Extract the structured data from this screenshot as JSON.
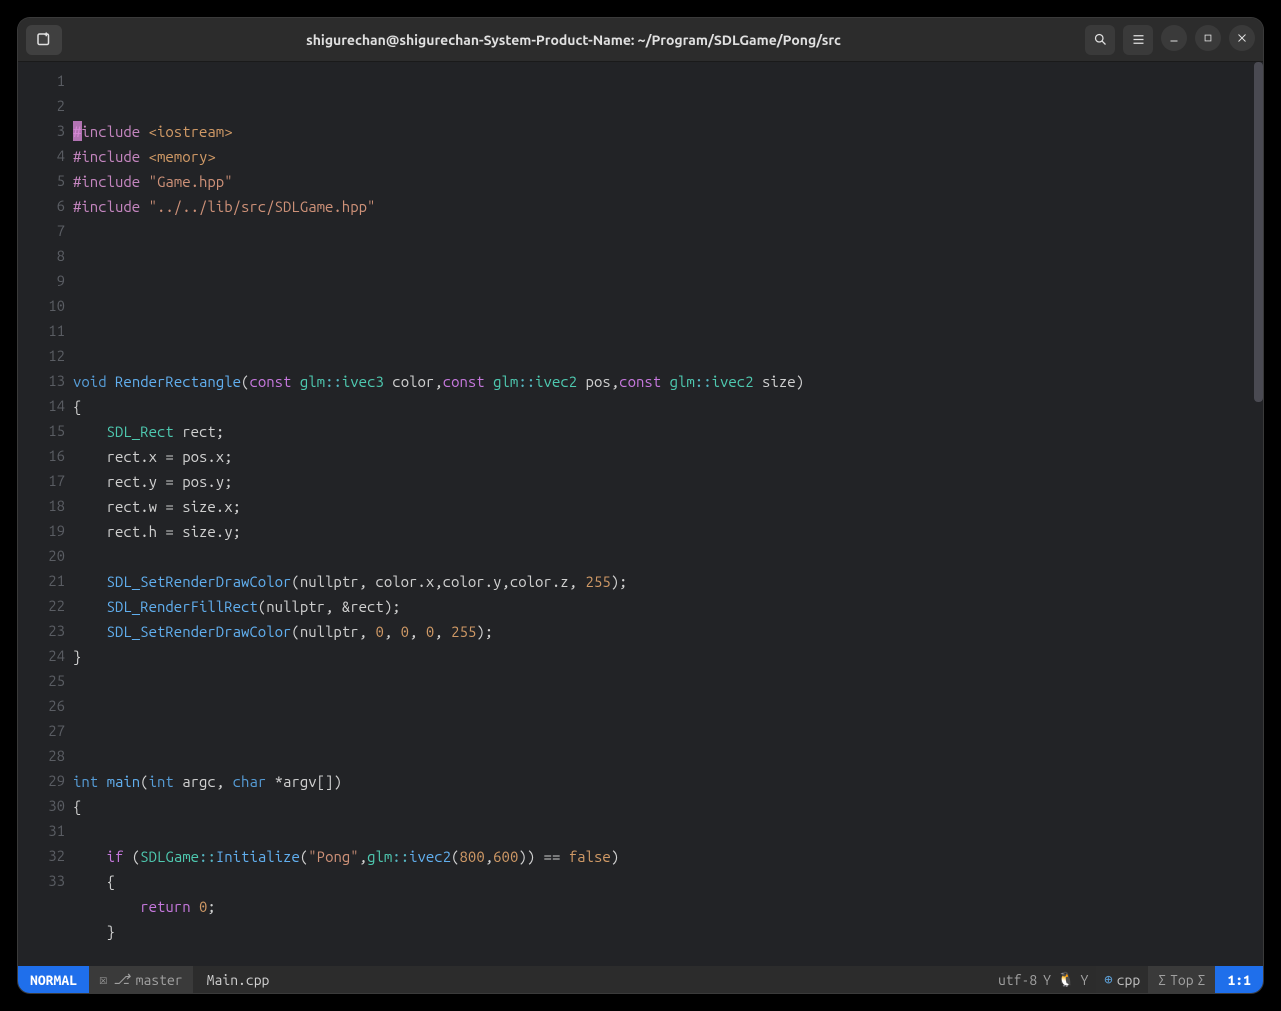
{
  "window": {
    "title": "shigurechan@shigurechan-System-Product-Name: ~/Program/SDLGame/Pong/src"
  },
  "statusbar": {
    "mode": "NORMAL",
    "branch": "master",
    "filename": "Main.cpp",
    "encoding": "utf-8",
    "filetype": "cpp",
    "scroll": "Top",
    "cursor": "1:1"
  },
  "gutter": {
    "start": 1,
    "end": 33
  },
  "code": {
    "lines": [
      {
        "n": 1,
        "t": "pre",
        "html": "<span class='pre'>#include</span> <span class='inc'>&lt;iostream&gt;</span>"
      },
      {
        "n": 2,
        "t": "pre",
        "html": "<span class='pre'>#include</span> <span class='inc'>&lt;memory&gt;</span>"
      },
      {
        "n": 3,
        "t": "pre",
        "html": "<span class='pre'>#include</span> <span class='str'>\"Game.hpp\"</span>"
      },
      {
        "n": 4,
        "t": "pre",
        "html": "<span class='pre'>#include</span> <span class='str'>\"../../lib/src/SDLGame.hpp\"</span>"
      },
      {
        "n": 5,
        "html": ""
      },
      {
        "n": 6,
        "html": ""
      },
      {
        "n": 7,
        "html": ""
      },
      {
        "n": 8,
        "html": ""
      },
      {
        "n": 9,
        "html": ""
      },
      {
        "n": 10,
        "html": ""
      },
      {
        "n": 11,
        "html": "<span class='kw'>void</span> <span class='func'>RenderRectangle</span>(<span class='const-kw'>const</span> <span class='type'>glm</span><span class='op'>::</span><span class='type'>ivec3</span> color,<span class='const-kw'>const</span> <span class='type'>glm</span><span class='op'>::</span><span class='type'>ivec2</span> pos,<span class='const-kw'>const</span> <span class='type'>glm</span><span class='op'>::</span><span class='type'>ivec2</span> size)"
      },
      {
        "n": 12,
        "html": "{"
      },
      {
        "n": 13,
        "html": "    <span class='type'>SDL_Rect</span> rect;"
      },
      {
        "n": 14,
        "html": "    rect.x = pos.x;"
      },
      {
        "n": 15,
        "html": "    rect.y = pos.y;"
      },
      {
        "n": 16,
        "html": "    rect.w = size.x;"
      },
      {
        "n": 17,
        "html": "    rect.h = size.y;"
      },
      {
        "n": 18,
        "html": ""
      },
      {
        "n": 19,
        "html": "    <span class='func'>SDL_SetRenderDrawColor</span>(nullptr, color.x,color.y,color.z, <span class='num'>255</span>);"
      },
      {
        "n": 20,
        "html": "    <span class='func'>SDL_RenderFillRect</span>(nullptr, &amp;rect);"
      },
      {
        "n": 21,
        "html": "    <span class='func'>SDL_SetRenderDrawColor</span>(nullptr, <span class='num'>0</span>, <span class='num'>0</span>, <span class='num'>0</span>, <span class='num'>255</span>);"
      },
      {
        "n": 22,
        "html": "}"
      },
      {
        "n": 23,
        "html": ""
      },
      {
        "n": 24,
        "html": ""
      },
      {
        "n": 25,
        "html": ""
      },
      {
        "n": 26,
        "html": ""
      },
      {
        "n": 27,
        "html": "<span class='kw'>int</span> <span class='func'>main</span>(<span class='kw'>int</span> argc, <span class='kw'>char</span> *argv[])"
      },
      {
        "n": 28,
        "html": "{"
      },
      {
        "n": 29,
        "html": ""
      },
      {
        "n": 30,
        "html": "    <span class='const-kw'>if</span> (<span class='type'>SDLGame</span><span class='op'>::</span><span class='func'>Initialize</span>(<span class='str'>\"Pong\"</span>,<span class='type'>glm</span><span class='op'>::</span><span class='func'>ivec2</span>(<span class='num'>800</span>,<span class='num'>600</span>)) == <span class='false-kw'>false</span>)"
      },
      {
        "n": 31,
        "html": "    {"
      },
      {
        "n": 32,
        "html": "        <span class='const-kw'>return</span> <span class='num'>0</span>;"
      },
      {
        "n": 33,
        "html": "    }"
      }
    ]
  }
}
